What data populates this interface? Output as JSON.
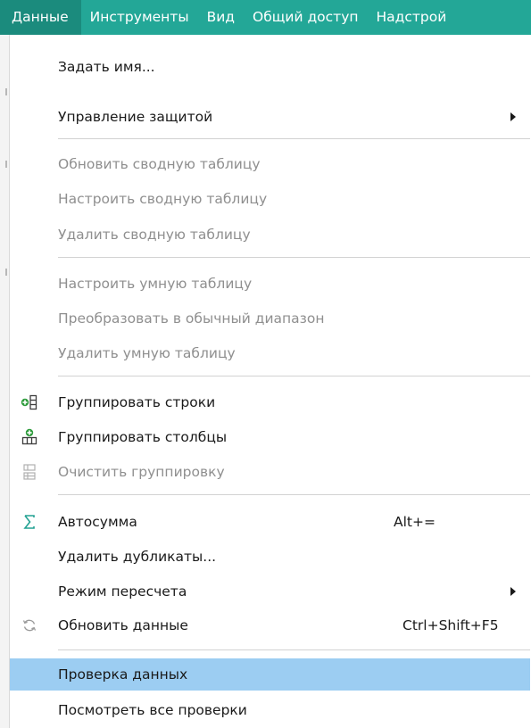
{
  "menubar": {
    "items": [
      {
        "label": "Данные"
      },
      {
        "label": "Инструменты"
      },
      {
        "label": "Вид"
      },
      {
        "label": "Общий доступ"
      },
      {
        "label": "Надстрой"
      }
    ],
    "active_color": "#1b8b7d",
    "bar_color": "#23a797"
  },
  "menu": {
    "items": [
      {
        "label": "Задать имя..."
      },
      {
        "label": "Управление защитой",
        "submenu": true
      },
      {
        "label": "Обновить сводную таблицу",
        "disabled": true
      },
      {
        "label": "Настроить сводную таблицу",
        "disabled": true
      },
      {
        "label": "Удалить сводную таблицу",
        "disabled": true
      },
      {
        "label": "Настроить умную таблицу",
        "disabled": true
      },
      {
        "label": "Преобразовать в обычный диапазон",
        "disabled": true
      },
      {
        "label": "Удалить умную таблицу",
        "disabled": true
      },
      {
        "label": "Группировать строки",
        "icon": "group-rows-icon"
      },
      {
        "label": "Группировать столбцы",
        "icon": "group-columns-icon"
      },
      {
        "label": "Очистить группировку",
        "icon": "clear-grouping-icon",
        "disabled": true
      },
      {
        "label": "Автосумма",
        "icon": "sigma-icon",
        "shortcut": "Alt+="
      },
      {
        "label": "Удалить дубликаты..."
      },
      {
        "label": "Режим пересчета",
        "submenu": true
      },
      {
        "label": "Обновить данные",
        "icon": "refresh-icon",
        "shortcut": "Ctrl+Shift+F5"
      },
      {
        "label": "Проверка данных",
        "highlighted": true
      },
      {
        "label": "Посмотреть все проверки"
      }
    ],
    "highlight_color": "#9ccdf2",
    "disabled_text_color": "#8f8f8f"
  }
}
